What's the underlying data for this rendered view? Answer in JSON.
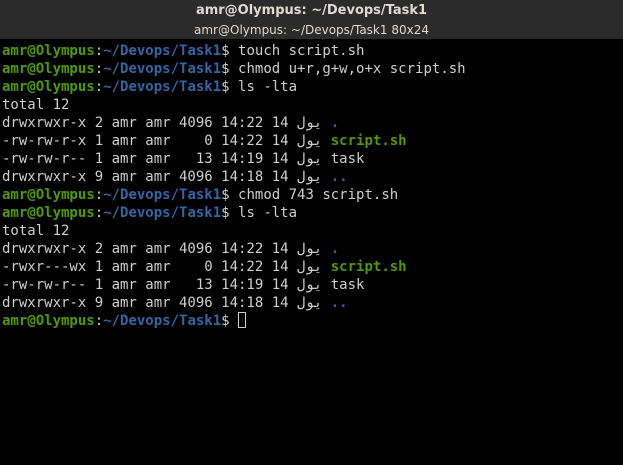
{
  "window": {
    "title": "amr@Olympus: ~/Devops/Task1",
    "subtitle": "amr@Olympus: ~/Devops/Task1 80x24"
  },
  "terminal": {
    "prompt_user": "amr@Olympus",
    "prompt_colon": ":",
    "prompt_path": "~/Devops/Task1",
    "prompt_dollar": "$ ",
    "lines": [
      {
        "type": "prompt",
        "command": "touch script.sh"
      },
      {
        "type": "prompt",
        "command": "chmod u+r,g+w,o+x script.sh"
      },
      {
        "type": "prompt",
        "command": "ls -lta"
      },
      {
        "type": "output",
        "text": "total 12"
      },
      {
        "type": "listing",
        "text": "drwxrwxr-x 2 amr amr 4096 14:22 14 يول ",
        "name": ".",
        "kind": "dir"
      },
      {
        "type": "listing",
        "text": "-rw-rw-r-x 1 amr amr    0 14:22 14 يول ",
        "name": "script.sh",
        "kind": "exec"
      },
      {
        "type": "listing",
        "text": "-rw-rw-r-- 1 amr amr   13 14:19 14 يول ",
        "name": "task",
        "kind": "file"
      },
      {
        "type": "listing",
        "text": "drwxrwxr-x 9 amr amr 4096 14:18 14 يول ",
        "name": "..",
        "kind": "dir"
      },
      {
        "type": "prompt",
        "command": "chmod 743 script.sh"
      },
      {
        "type": "prompt",
        "command": "ls -lta"
      },
      {
        "type": "output",
        "text": "total 12"
      },
      {
        "type": "listing",
        "text": "drwxrwxr-x 2 amr amr 4096 14:22 14 يول ",
        "name": ".",
        "kind": "dir"
      },
      {
        "type": "listing",
        "text": "-rwxr---wx 1 amr amr    0 14:22 14 يول ",
        "name": "script.sh",
        "kind": "exec"
      },
      {
        "type": "listing",
        "text": "-rw-rw-r-- 1 amr amr   13 14:19 14 يول ",
        "name": "task",
        "kind": "file"
      },
      {
        "type": "listing",
        "text": "drwxrwxr-x 9 amr amr 4096 14:18 14 يول ",
        "name": "..",
        "kind": "dir"
      },
      {
        "type": "prompt",
        "command": "",
        "cursor": true
      }
    ]
  },
  "colors": {
    "background": "#000000",
    "titlebar": "#2b2b2b",
    "user_green": "#4e9a06",
    "path_blue": "#3465a4",
    "text": "#cfcfcf"
  }
}
